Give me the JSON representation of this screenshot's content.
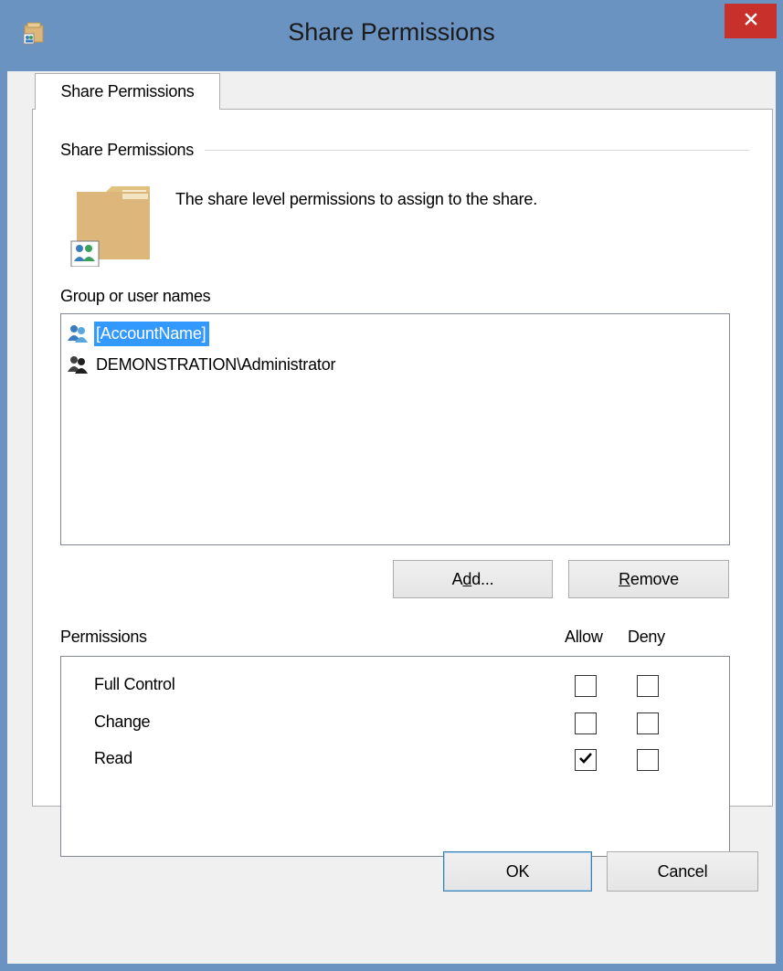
{
  "window": {
    "title": "Share Permissions",
    "close_icon": "close-icon"
  },
  "tabs": [
    {
      "label": "Share Permissions",
      "active": true
    }
  ],
  "group": {
    "heading": "Share Permissions",
    "description": "The share level permissions to assign to the share.",
    "icon": "shared-folder-icon"
  },
  "users": {
    "label": "Group or user names",
    "items": [
      {
        "name": "[AccountName]",
        "icon": "user-group-icon",
        "selected": true
      },
      {
        "name": "DEMONSTRATION\\Administrator",
        "icon": "user-group-icon",
        "selected": false
      }
    ],
    "add_button": {
      "pre": "A",
      "accel": "d",
      "post": "d..."
    },
    "remove_button": {
      "pre": "",
      "accel": "R",
      "post": "emove"
    }
  },
  "permissions": {
    "label": "Permissions",
    "allow_header": "Allow",
    "deny_header": "Deny",
    "rows": [
      {
        "name": "Full Control",
        "allow": false,
        "deny": false
      },
      {
        "name": "Change",
        "allow": false,
        "deny": false
      },
      {
        "name": "Read",
        "allow": true,
        "deny": false
      }
    ]
  },
  "footer": {
    "ok_label": "OK",
    "cancel_label": "Cancel"
  },
  "colors": {
    "titlebar": "#6b93c2",
    "close_button": "#c7302b",
    "selection": "#3399ff",
    "folder": "#dcb67a"
  }
}
